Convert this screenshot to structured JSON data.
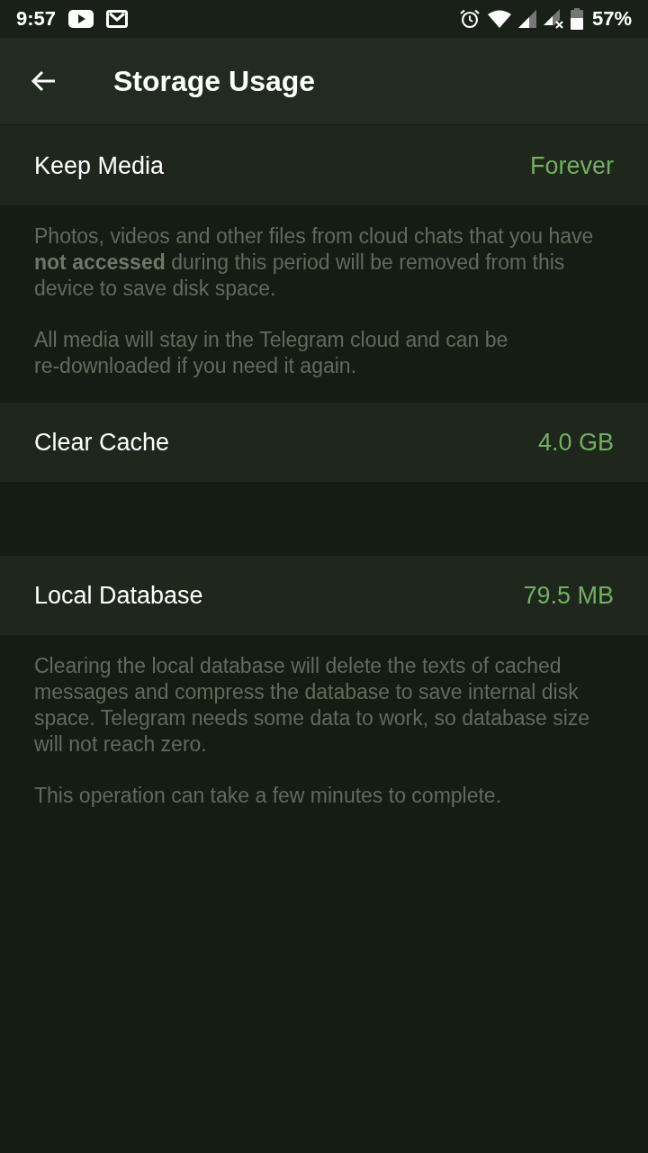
{
  "status_bar": {
    "time": "9:57",
    "battery": "57%"
  },
  "app_bar": {
    "title": "Storage Usage"
  },
  "sections": [
    {
      "rows": [
        {
          "label": "Keep Media",
          "value": "Forever"
        }
      ],
      "notes": [
        "Photos, videos and other files from cloud chats that you have **not accessed** during this period will be removed from this device to save disk space.",
        "All media will stay in the Telegram cloud and can be re-downloaded if you need it again."
      ]
    },
    {
      "rows": [
        {
          "label": "Clear Cache",
          "value": "4.0 GB"
        }
      ]
    },
    {
      "rows": [
        {
          "label": "Local Database",
          "value": "79.5 MB"
        }
      ],
      "notes": [
        "Clearing the local database will delete the texts of cached messages and compress the database to save internal disk space. Telegram needs some data to work, so database size will not reach zero.",
        "This operation can take a few minutes to complete."
      ]
    }
  ]
}
